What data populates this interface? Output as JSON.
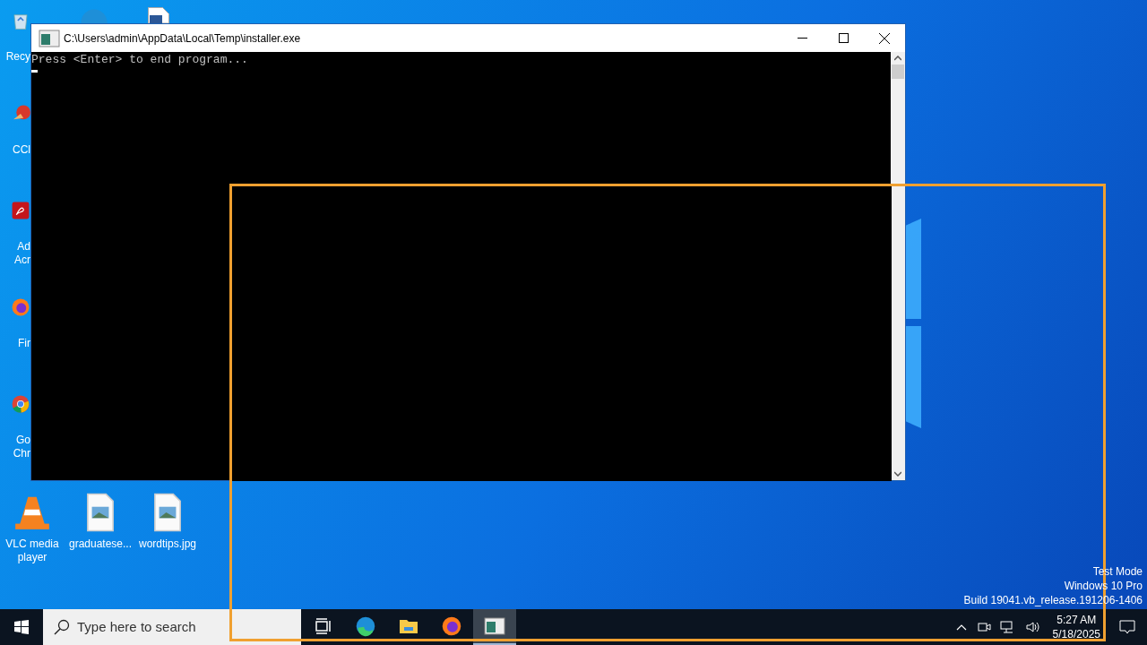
{
  "desktop": {
    "icons": [
      {
        "kind": "recycle",
        "lines": [
          "Recy"
        ]
      },
      {
        "kind": "edge"
      },
      {
        "kind": "document"
      },
      {
        "kind": "ccleaner",
        "lines": [
          "CCl"
        ]
      },
      {
        "kind": "acrobat",
        "lines": [
          "Ad",
          "Acr"
        ]
      },
      {
        "kind": "firefox",
        "lines": [
          "Fir"
        ]
      },
      {
        "kind": "chrome",
        "lines": [
          "Go",
          "Chr"
        ]
      },
      {
        "kind": "vlc",
        "lines": [
          "VLC media",
          "player"
        ]
      },
      {
        "kind": "image",
        "lines": [
          "graduatese..."
        ]
      },
      {
        "kind": "image",
        "lines": [
          "wordtips.jpg"
        ]
      }
    ],
    "watermark": [
      "Test Mode",
      "Windows 10 Pro",
      "Build 19041.vb_release.191206-1406"
    ]
  },
  "console": {
    "title": "C:\\Users\\admin\\AppData\\Local\\Temp\\installer.exe",
    "lines": [
      "Press <Enter> to end program..."
    ],
    "cursor": true
  },
  "taskbar": {
    "search": {
      "placeholder": "Type here to search"
    },
    "apps": [
      {
        "kind": "taskview",
        "selected": false
      },
      {
        "kind": "edge",
        "selected": false
      },
      {
        "kind": "explorer",
        "selected": false
      },
      {
        "kind": "firefox",
        "selected": false
      },
      {
        "kind": "console",
        "selected": true
      }
    ],
    "clock": {
      "time": "5:27 AM",
      "date": "5/18/2025"
    }
  }
}
